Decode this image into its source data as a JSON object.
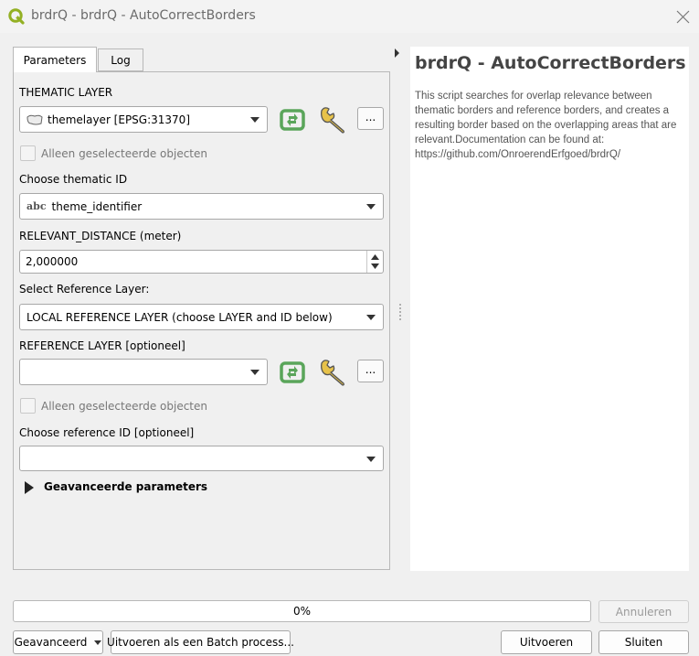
{
  "window": {
    "title": "brdrQ - brdrQ - AutoCorrectBorders",
    "app_icon": "qgis-icon",
    "close_icon": "close-icon"
  },
  "tabs": [
    {
      "label": "Parameters",
      "active": true
    },
    {
      "label": "Log",
      "active": false
    }
  ],
  "params": {
    "thematic_layer": {
      "label": "THEMATIC LAYER",
      "value": "themelayer [EPSG:31370]",
      "ellipsis": "..."
    },
    "thematic_selected_only": {
      "label": "Alleen geselecteerde objecten",
      "checked": false
    },
    "thematic_id": {
      "label": "Choose thematic ID",
      "prefix": "abc",
      "value": "theme_identifier"
    },
    "relevant_distance": {
      "label": "RELEVANT_DISTANCE (meter)",
      "value": "2,000000"
    },
    "reference_select": {
      "label": "Select Reference Layer:",
      "value": "LOCAL REFERENCE LAYER (choose LAYER and ID below)"
    },
    "reference_layer": {
      "label": "REFERENCE LAYER [optioneel]",
      "value": "",
      "ellipsis": "..."
    },
    "reference_selected_only": {
      "label": "Alleen geselecteerde objecten",
      "checked": false
    },
    "reference_id": {
      "label": "Choose reference ID [optioneel]",
      "value": ""
    },
    "advanced": {
      "label": "Geavanceerde parameters",
      "expanded": false
    }
  },
  "help": {
    "title": "brdrQ - AutoCorrectBorders",
    "body": "This script searches for overlap relevance between thematic borders and reference borders, and creates a resulting border based on the overlapping areas that are relevant.Documentation can be found at: https://github.com/OnroerendErfgoed/brdrQ/"
  },
  "progress": {
    "text": "0%",
    "value": 0
  },
  "buttons": {
    "cancel": "Annuleren",
    "advanced": "Geavanceerd",
    "batch": "Uitvoeren als een Batch process...",
    "run": "Uitvoeren",
    "close": "Sluiten"
  },
  "colors": {
    "iterate_icon": "#5aa55a",
    "qgis_green": "#93b023"
  }
}
